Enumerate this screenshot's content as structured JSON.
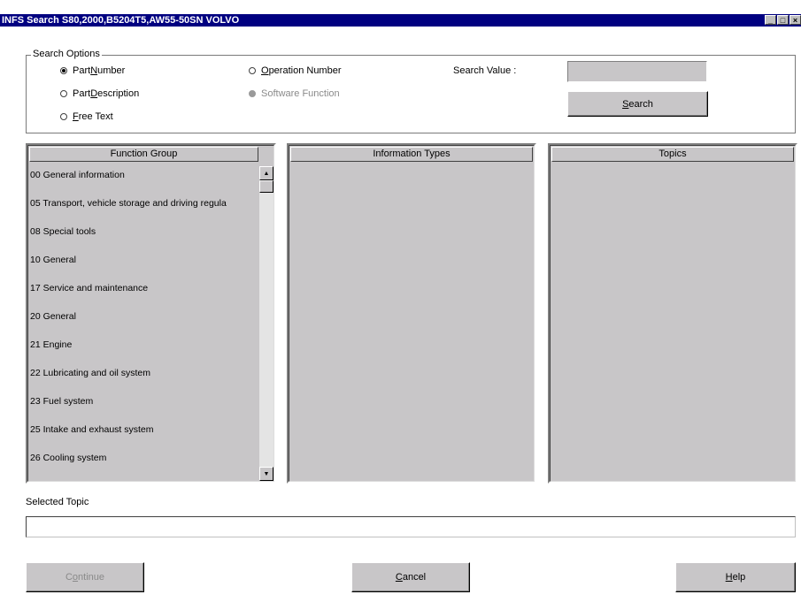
{
  "window": {
    "title": "INFS Search S80,2000,B5204T5,AW55-50SN VOLVO",
    "minimize": "_",
    "maximize": "□",
    "close": "×"
  },
  "search_options": {
    "group_label": "Search Options",
    "options": [
      {
        "label_pre": "Part ",
        "label_u": "N",
        "label_post": "umber",
        "selected": true,
        "enabled": true
      },
      {
        "label_pre": "Part ",
        "label_u": "D",
        "label_post": "escription",
        "selected": false,
        "enabled": true
      },
      {
        "label_pre": "",
        "label_u": "F",
        "label_post": "ree Text",
        "selected": false,
        "enabled": true
      },
      {
        "label_pre": "",
        "label_u": "O",
        "label_post": "peration Number",
        "selected": false,
        "enabled": true
      },
      {
        "label_pre": "Software Function",
        "label_u": "",
        "label_post": "",
        "selected": false,
        "enabled": false
      }
    ],
    "search_value_label": "Search Value :",
    "search_value": "",
    "search_button_u": "S",
    "search_button_rest": "earch"
  },
  "panels": {
    "function_group": {
      "header": "Function Group",
      "items": [
        "00 General information",
        "05 Transport, vehicle storage and driving regula",
        "08 Special tools",
        "10 General",
        "17 Service and maintenance",
        "20 General",
        "21 Engine",
        "22 Lubricating and oil system",
        "23 Fuel system",
        "25 Intake and exhaust system",
        "26 Cooling system"
      ]
    },
    "information_types": {
      "header": "Information Types",
      "items": []
    },
    "topics": {
      "header": "Topics",
      "items": []
    }
  },
  "selected_topic": {
    "label": "Selected Topic",
    "value": ""
  },
  "footer": {
    "continue_pre": "C",
    "continue_u": "o",
    "continue_post": "ntinue",
    "cancel_u": "C",
    "cancel_post": "ancel",
    "help_u": "H",
    "help_post": "elp"
  },
  "colors": {
    "title_bar": "#000080",
    "panel_bg": "#c8c6c8",
    "disabled_text": "#8a8a8a"
  }
}
